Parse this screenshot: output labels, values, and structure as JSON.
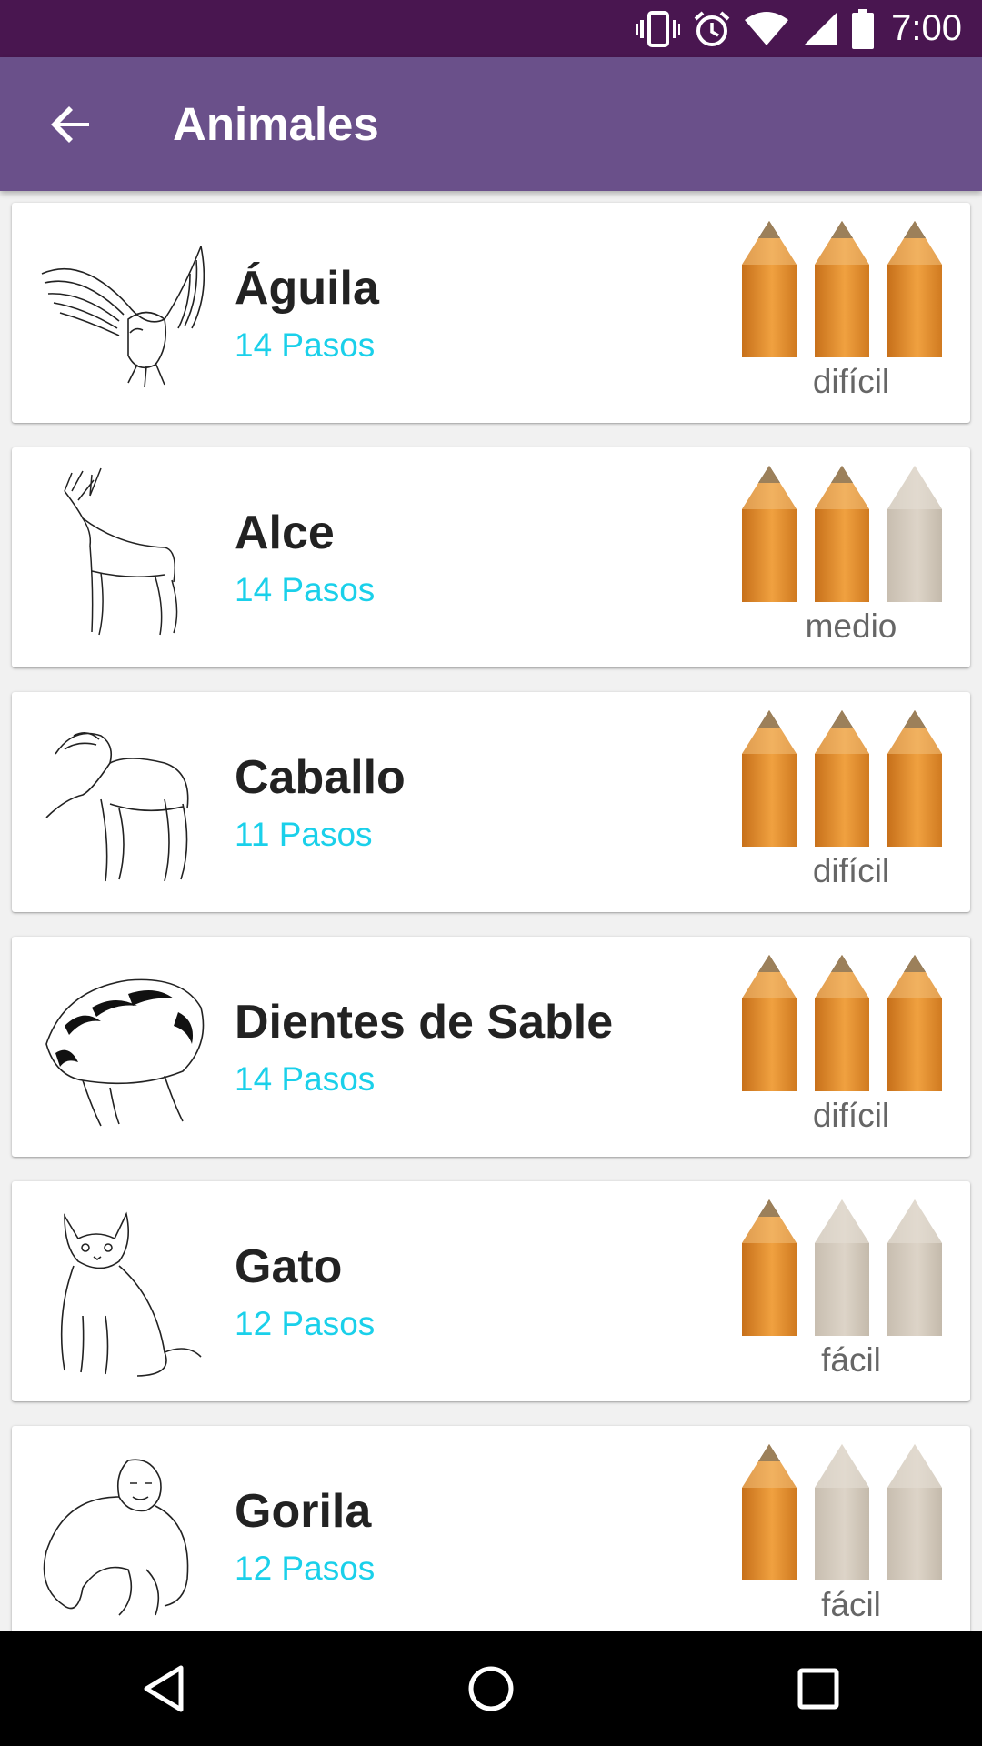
{
  "status_bar": {
    "time": "7:00",
    "icons": [
      "vibrate-icon",
      "alarm-icon",
      "wifi-icon",
      "signal-icon",
      "battery-icon"
    ]
  },
  "app_bar": {
    "title": "Animales",
    "back_icon": "arrow-back-icon"
  },
  "colors": {
    "status_bar": "#491650",
    "app_bar": "#6a508a",
    "steps_text": "#1ad0ea",
    "pencil_active": "#e8922f",
    "pencil_inactive": "#cfc5b8"
  },
  "items": [
    {
      "title": "Águila",
      "steps": "14 Pasos",
      "difficulty": "difícil",
      "level": 3,
      "thumb_icon": "eagle-drawing"
    },
    {
      "title": "Alce",
      "steps": "14 Pasos",
      "difficulty": "medio",
      "level": 2,
      "thumb_icon": "moose-drawing"
    },
    {
      "title": "Caballo",
      "steps": "11 Pasos",
      "difficulty": "difícil",
      "level": 3,
      "thumb_icon": "horse-drawing"
    },
    {
      "title": "Dientes de Sable",
      "steps": "14 Pasos",
      "difficulty": "difícil",
      "level": 3,
      "thumb_icon": "sabertooth-drawing"
    },
    {
      "title": "Gato",
      "steps": "12 Pasos",
      "difficulty": "fácil",
      "level": 1,
      "thumb_icon": "cat-drawing"
    },
    {
      "title": "Gorila",
      "steps": "12 Pasos",
      "difficulty": "fácil",
      "level": 1,
      "thumb_icon": "gorilla-drawing"
    }
  ],
  "nav_bar": {
    "buttons": [
      "back-triangle-icon",
      "home-circle-icon",
      "recents-square-icon"
    ]
  }
}
